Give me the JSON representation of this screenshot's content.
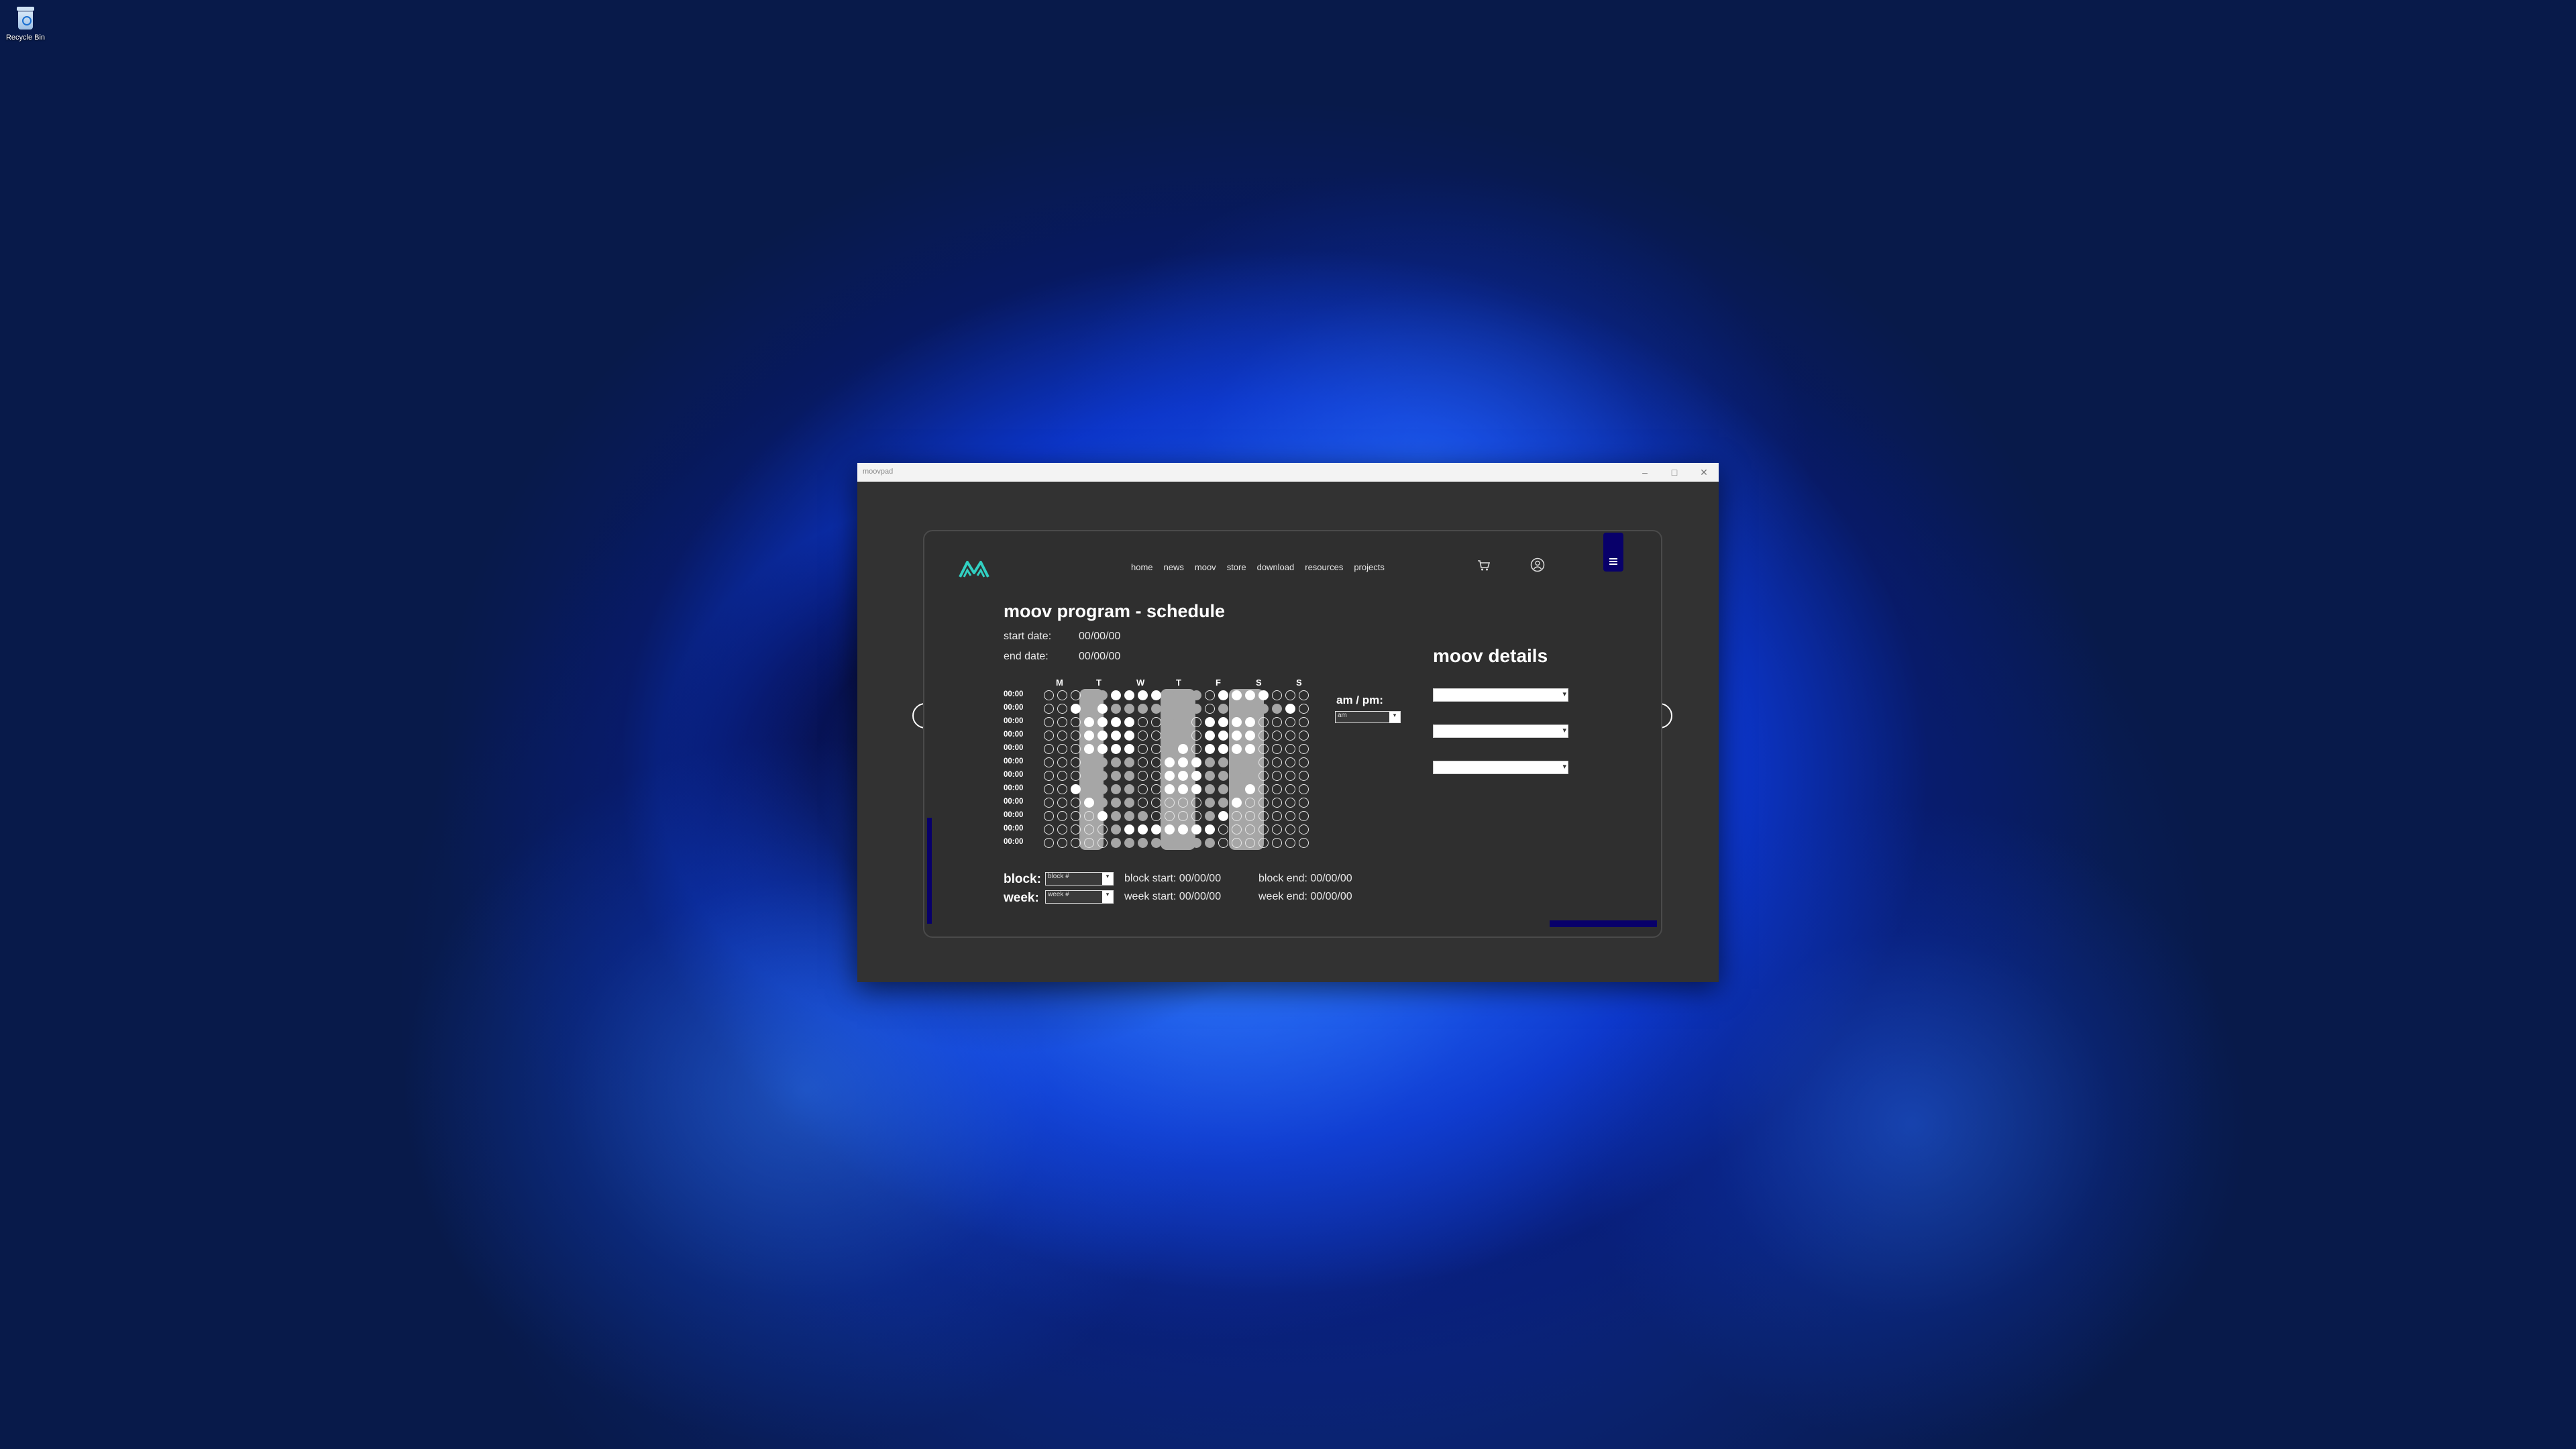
{
  "desktop": {
    "recycle_bin_label": "Recycle Bin"
  },
  "window": {
    "title": "moovpad",
    "minimize": "–",
    "maximize": "□",
    "close": "✕"
  },
  "nav": {
    "items": [
      "home",
      "news",
      "moov",
      "store",
      "download",
      "resources",
      "projects"
    ]
  },
  "icons": {
    "logo": "moov-logo",
    "cart": "cart-icon",
    "account": "account-icon",
    "menu": "menu-icon"
  },
  "schedule": {
    "title": "moov program - schedule",
    "start_date_label": "start date:",
    "start_date_value": "00/00/00",
    "end_date_label": "end date:",
    "end_date_value": "00/00/00",
    "days": [
      "M",
      "T",
      "W",
      "T",
      "F",
      "S",
      "S"
    ],
    "times": [
      "00:00",
      "00:00",
      "00:00",
      "00:00",
      "00:00",
      "00:00",
      "00:00",
      "00:00",
      "00:00",
      "00:00",
      "00:00",
      "00:00"
    ],
    "grid": [
      "EEEGGWWWWGGGEWWWWEEE",
      "EEWGWGGGGGGGEGGGGGWE",
      "EEEWWWWEEGGEWWWWEEEE",
      "EEEWWWWEEGGEWWWWEEEE",
      "EEEWWWWEEGWEWWWWEEEE",
      "EEEGGGGEEWWWGGGGEEEE",
      "EEEGGGGEEWWWGGGGEEEE",
      "EEWGGGGEEWWWGGGWEEEE",
      "EEEWGGGEEEEEGGWEEEEE",
      "EEEEWGGGEEEEGWEEEEEE",
      "EEEEEGWWWWWWWEEEEEEE",
      "EEEEEGGGGGGGGEEEEEEE"
    ],
    "ampm_label": "am / pm:",
    "ampm_value": "am",
    "block_label": "block:",
    "block_placeholder": "block #",
    "week_label": "week:",
    "week_placeholder": "week #",
    "block_start": "block start: 00/00/00",
    "block_end": "block end: 00/00/00",
    "week_start": "week start: 00/00/00",
    "week_end": "week end: 00/00/00"
  },
  "details": {
    "title": "moov details",
    "selects": [
      "",
      "",
      ""
    ]
  }
}
